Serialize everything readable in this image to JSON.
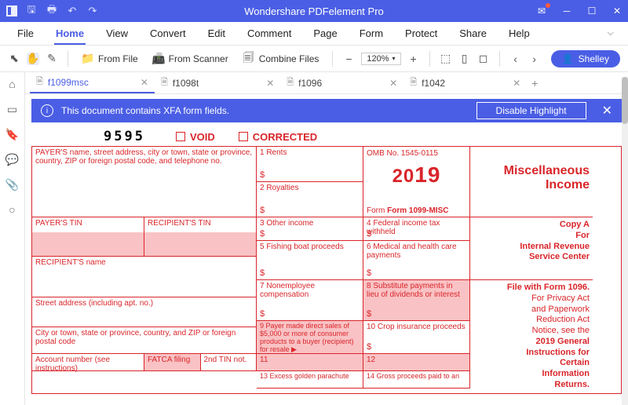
{
  "app": {
    "title": "Wondershare PDFelement Pro"
  },
  "menu": {
    "file": "File",
    "home": "Home",
    "view": "View",
    "convert": "Convert",
    "edit": "Edit",
    "comment": "Comment",
    "page": "Page",
    "form": "Form",
    "protect": "Protect",
    "share": "Share",
    "help": "Help"
  },
  "toolbar": {
    "from_file": "From File",
    "from_scanner": "From Scanner",
    "combine": "Combine Files",
    "zoom": "120%",
    "user": "Shelley"
  },
  "tabs": [
    {
      "label": "f1099msc",
      "active": true
    },
    {
      "label": "f1098t",
      "active": false
    },
    {
      "label": "f1096",
      "active": false
    },
    {
      "label": "f1042",
      "active": false
    }
  ],
  "notice": {
    "text": "This document contains XFA form fields.",
    "btn": "Disable Highlight"
  },
  "form": {
    "num": "9595",
    "void": "VOID",
    "corrected": "CORRECTED",
    "payer_block": "PAYER'S name, street address, city or town, state or province, country, ZIP or foreign postal code, and telephone no.",
    "c1": "1 Rents",
    "c2": "2 Royalties",
    "c3": "3 Other income",
    "c4": "4 Federal income tax withheld",
    "c5": "5 Fishing boat proceeds",
    "c6": "6 Medical and health care payments",
    "c7": "7 Nonemployee compensation",
    "c8": "8 Substitute payments in lieu of dividends or interest",
    "c9": "9 Payer made direct sales of $5,000 or more of consumer products to a buyer (recipient) for resale ▶",
    "c10": "10 Crop insurance proceeds",
    "c11": "11",
    "c12": "12",
    "c13": "13 Excess golden parachute",
    "c14": "14 Gross proceeds paid to an",
    "omb": "OMB No. 1545-0115",
    "year_a": "20",
    "year_b": "19",
    "form_no": "Form 1099-MISC",
    "title_a": "Miscellaneous",
    "title_b": "Income",
    "payer_tin": "PAYER'S TIN",
    "recip_tin": "RECIPIENT'S TIN",
    "recip_name": "RECIPIENT'S name",
    "street": "Street address (including apt. no.)",
    "city": "City or town, state or province, country, and ZIP or foreign postal code",
    "acct": "Account number (see instructions)",
    "fatca": "FATCA filing",
    "tin2": "2nd TIN not.",
    "side": {
      "copy": "Copy A",
      "for": "For",
      "irs1": "Internal Revenue",
      "irs2": "Service Center",
      "file": "File with Form 1096.",
      "p1": "For Privacy Act",
      "p2": "and Paperwork",
      "p3": "Reduction Act",
      "p4": "Notice, see the",
      "p5": "2019 General",
      "p6": "Instructions for",
      "p7": "Certain",
      "p8": "Information",
      "p9": "Returns."
    },
    "d": "$"
  }
}
